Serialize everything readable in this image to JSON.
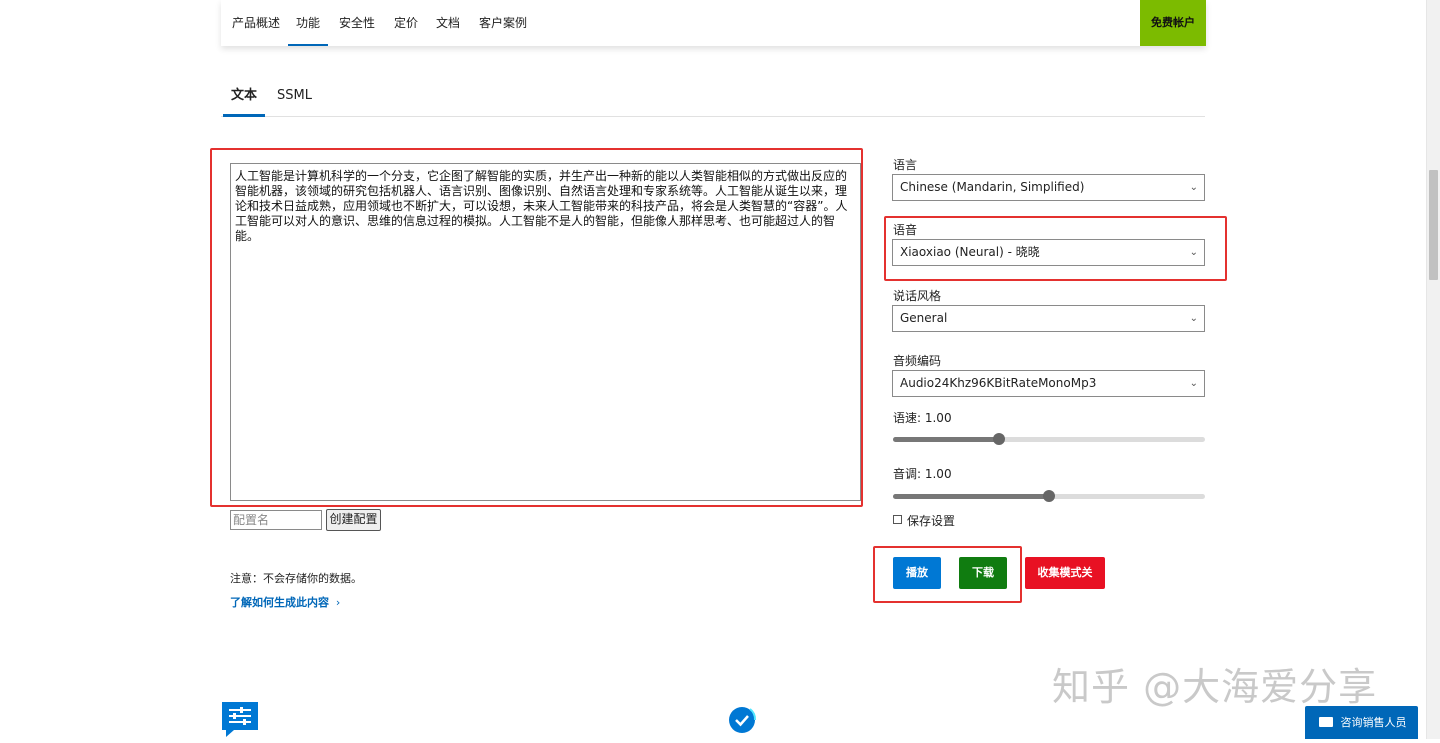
{
  "nav": {
    "items": [
      "产品概述",
      "功能",
      "安全性",
      "定价",
      "文档",
      "客户案例"
    ],
    "active": "功能",
    "free_account": "免费帐户"
  },
  "tabs": {
    "text": "文本",
    "ssml": "SSML"
  },
  "editor": {
    "text": "人工智能是计算机科学的一个分支，它企图了解智能的实质，并生产出一种新的能以人类智能相似的方式做出反应的智能机器，该领域的研究包括机器人、语言识别、图像识别、自然语言处理和专家系统等。人工智能从诞生以来，理论和技术日益成熟，应用领域也不断扩大，可以设想，未来人工智能带来的科技产品，将会是人类智慧的“容器”。人工智能可以对人的意识、思维的信息过程的模拟。人工智能不是人的智能，但能像人那样思考、也可能超过人的智能。",
    "config_placeholder": "配置名",
    "create_config": "创建配置",
    "note": "注意：不会存储你的数据。",
    "learn_link": "了解如何生成此内容",
    "learn_chevron": "›"
  },
  "settings": {
    "language_label": "语言",
    "language_value": "Chinese (Mandarin, Simplified)",
    "voice_label": "语音",
    "voice_value": "Xiaoxiao (Neural) - 晓晓",
    "style_label": "说话风格",
    "style_value": "General",
    "codec_label": "音频编码",
    "codec_value": "Audio24Khz96KBitRateMonoMp3",
    "speed_label": "语速: 1.00",
    "speed_fraction": 0.34,
    "pitch_label": "音调: 1.00",
    "pitch_fraction": 0.5,
    "save_settings": "保存设置",
    "chevron": "⌄"
  },
  "actions": {
    "play": "播放",
    "download": "下载",
    "collect_mode": "收集模式关"
  },
  "colors": {
    "play": "#0078d4",
    "download": "#107c10",
    "collect": "#e81123",
    "highlight": "#e4312f",
    "accent": "#0067b8",
    "free_account": "#7cbb00"
  },
  "watermark": "知乎 @大海爱分享",
  "consult": "咨询销售人员"
}
